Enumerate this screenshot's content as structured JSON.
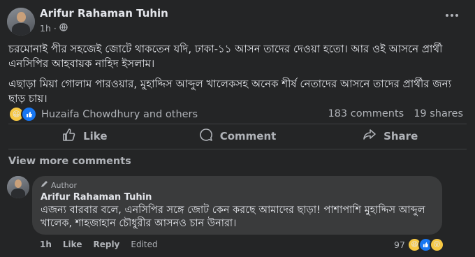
{
  "post": {
    "author": "Arifur Rahaman Tuhin",
    "time": "1h",
    "paragraph1": "চরমোনাই পীর সহজেই জোটে থাকতেন যদি, ঢাকা-১১ আসন তাদের দেওয়া হতো। আর ওই আসনে প্রার্থী এনসিপির আহবায়ক নাহিদ ইসলাম।",
    "paragraph2": "এছাড়া মিয়া গোলাম পারওয়ার, মুহাদ্দিস আব্দুল খালেকসহ অনেক শীর্ষ নেতাদের আসনে তাদের প্রার্থীর জন্য ছাড় চায়।",
    "reaction_names": "Huzaifa Chowdhury and others",
    "comments_count": "183 comments",
    "shares_count": "19 shares"
  },
  "actions": {
    "like": "Like",
    "comment": "Comment",
    "share": "Share"
  },
  "view_more_comments": "View more comments",
  "comment": {
    "badge": "Author",
    "author": "Arifur Rahaman Tuhin",
    "text": "এজন্য বারবার বলে, এনসিপির সঙ্গে জোট কেন করছে আমাদের ছাড়া! পাশাপাশি মুহাদ্দিস আব্দুল খালেক, শাহজাহান চৌধুরীর আসনও চান উনারা।",
    "time": "1h",
    "like": "Like",
    "reply": "Reply",
    "edited": "Edited",
    "reaction_count": "97"
  },
  "icons": [
    "globe-icon",
    "more-options-icon",
    "haha-reaction-icon",
    "like-reaction-icon",
    "like-icon",
    "comment-icon",
    "share-icon",
    "pencil-icon",
    "wow-reaction-icon"
  ],
  "colors": {
    "background": "#242526",
    "bubble": "#3a3b3c",
    "text": "#e4e6eb",
    "muted": "#b0b3b8",
    "like_blue": "#1877f2"
  }
}
